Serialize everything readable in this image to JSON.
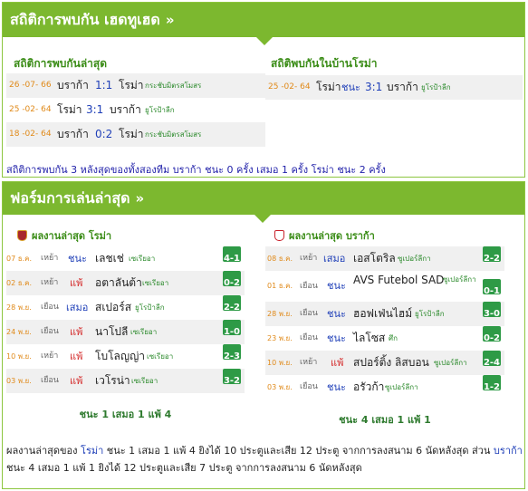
{
  "h2h": {
    "title": "สถิติการพบกัน เฮดทูเฮด",
    "arrow": "»",
    "recent_title": "สถิติการพบกันล่าสุด",
    "recent": [
      {
        "date": "26 -07- 66",
        "home": "บราก้า",
        "score": "1:1",
        "away": "โรม่า",
        "comp": "กระชับมิตรสโมสร"
      },
      {
        "date": "25 -02- 64",
        "home": "โรม่า",
        "score": "3:1",
        "away": "บราก้า",
        "comp": "ยูโรป้าลีก"
      },
      {
        "date": "18 -02- 64",
        "home": "บราก้า",
        "score": "0:2",
        "away": "โรม่า",
        "comp": "กระชับมิตรสโมสร"
      }
    ],
    "home_title": "สถิติพบกันในบ้านโรม่า",
    "home_games": [
      {
        "date": "25 -02- 64",
        "home": "โรม่า",
        "result": "ชนะ",
        "score": "3:1",
        "away": "บราก้า",
        "comp": "ยูโรป้าลีก"
      }
    ],
    "summary": "สถิติการพบกัน 3 หลังสุดของทั้งสองทีม บราก้า ชนะ 0 ครั้ง เสมอ 1 ครั้ง โรม่า ชนะ 2 ครั้ง"
  },
  "form": {
    "title": "ฟอร์มการเล่นล่าสุด",
    "arrow": "»",
    "left_title": "ผลงานล่าสุด โรม่า",
    "right_title": "ผลงานล่าสุด บราก้า",
    "left": [
      {
        "date": "07 ธ.ค.",
        "venue": "เหย้า",
        "result": "ชนะ",
        "rtype": "win",
        "opp": "เลชเช่",
        "comp": "เซเรียอา",
        "score": "4-1"
      },
      {
        "date": "02 ธ.ค.",
        "venue": "เหย้า",
        "result": "แพ้",
        "rtype": "lose",
        "opp": "อตาลันต้า",
        "comp": "เซเรียอา",
        "score": "0-2"
      },
      {
        "date": "28 พ.ย.",
        "venue": "เยือน",
        "result": "เสมอ",
        "rtype": "draw",
        "opp": "สเปอร์ส",
        "comp": "ยูโรป้าลีก",
        "score": "2-2"
      },
      {
        "date": "24 พ.ย.",
        "venue": "เยือน",
        "result": "แพ้",
        "rtype": "lose",
        "opp": "นาโปลี",
        "comp": "เซเรียอา",
        "score": "1-0"
      },
      {
        "date": "10 พ.ย.",
        "venue": "เหย้า",
        "result": "แพ้",
        "rtype": "lose",
        "opp": "โบโลญญ่า",
        "comp": "เซเรียอา",
        "score": "2-3"
      },
      {
        "date": "03 พ.ย.",
        "venue": "เยือน",
        "result": "แพ้",
        "rtype": "lose",
        "opp": "เวโรน่า",
        "comp": "เซเรียอา",
        "score": "3-2"
      }
    ],
    "right": [
      {
        "date": "08 ธ.ค.",
        "venue": "เหย้า",
        "result": "เสมอ",
        "rtype": "draw",
        "opp": "เอสโตริล",
        "comp": "ซูเปอร์ลีกา",
        "score": "2-2"
      },
      {
        "date": "01 ธ.ค.",
        "venue": "เยือน",
        "result": "ชนะ",
        "rtype": "win",
        "opp": "AVS Futebol SAD",
        "comp": "ซูเปอร์ลีกา",
        "score": "0-1"
      },
      {
        "date": "28 พ.ย.",
        "venue": "เยือน",
        "result": "ชนะ",
        "rtype": "win",
        "opp": "ฮอฟเฟ่นไฮม์",
        "comp": "ยูโรป้าลีก",
        "score": "3-0"
      },
      {
        "date": "23 พ.ย.",
        "venue": "เยือน",
        "result": "ชนะ",
        "rtype": "win",
        "opp": "ไลโซส",
        "comp": "ศึก",
        "score": "0-2"
      },
      {
        "date": "10 พ.ย.",
        "venue": "เหย้า",
        "result": "แพ้",
        "rtype": "lose",
        "opp": "สปอร์ติ้ง ลิสบอน",
        "comp": "ซูเปอร์ลีกา",
        "score": "2-4"
      },
      {
        "date": "03 พ.ย.",
        "venue": "เยือน",
        "result": "ชนะ",
        "rtype": "win",
        "opp": "อรัวก้า",
        "comp": "ซูเปอร์ลีกา",
        "score": "1-2"
      }
    ],
    "left_total": "ชนะ 1 เสมอ 1 แพ้ 4",
    "right_total": "ชนะ 4 เสมอ 1 แพ้ 1",
    "bottom": {
      "p1": "ผลงานล่าสุดของ ",
      "t1": "โรม่า",
      "p2": " ชนะ 1 เสมอ 1 แพ้ 4 ยิงได้ 10 ประตูและเสีย 12 ประตู จากการลงสนาม 6 นัดหลังสุด ส่วน ",
      "t2": "บราก้า",
      "p3": " ชนะ 4 เสมอ 1 แพ้ 1 ยิงได้ 12 ประตูและเสีย 7 ประตู จากการลงสนาม 6 นัดหลังสุด"
    }
  },
  "colors": {
    "accent": "#7cb82f",
    "score_badge": "#2e9a46",
    "win": "#1f3fb8",
    "lose": "#d42a2a",
    "date": "#e08a1a"
  },
  "icons": {
    "roma_crest": "roma-crest-icon",
    "braga_crest": "braga-crest-icon"
  }
}
